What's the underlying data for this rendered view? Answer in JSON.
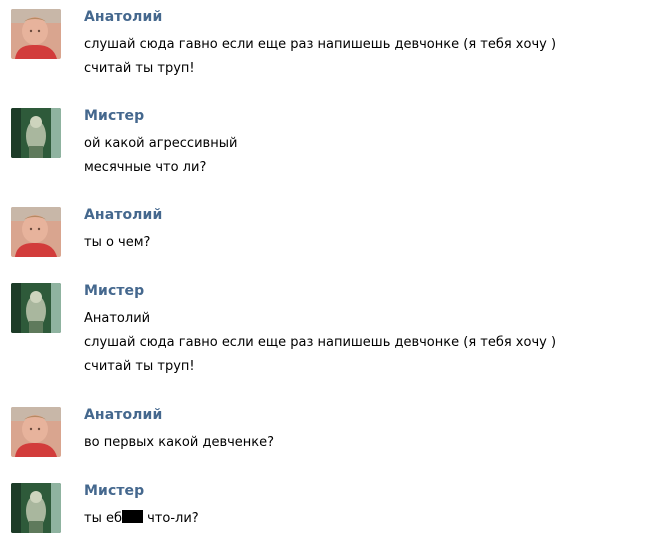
{
  "messages": [
    {
      "author": "Анатолий",
      "avatar_icon": "user-avatar-boy-red-shirt",
      "lines": [
        "слушай сюда гавно если еще раз напишешь девчонке (я тебя хочу )",
        "считай ты труп!"
      ]
    },
    {
      "author": "Мистер",
      "avatar_icon": "user-avatar-green-scene",
      "lines": [
        "ой какой агрессивный",
        "месячные что ли?"
      ]
    },
    {
      "author": "Анатолий",
      "avatar_icon": "user-avatar-boy-red-shirt",
      "lines": [
        "ты о чем?"
      ]
    },
    {
      "author": "Мистер",
      "avatar_icon": "user-avatar-green-scene",
      "lines": [
        "Анатолий",
        "слушай сюда гавно если еще раз напишешь девчонке (я тебя хочу )",
        "считай ты труп!"
      ]
    },
    {
      "author": "Анатолий",
      "avatar_icon": "user-avatar-boy-red-shirt",
      "lines": [
        "во первых какой девченке?"
      ]
    },
    {
      "author": "Мистер",
      "avatar_icon": "user-avatar-green-scene",
      "lines": [],
      "censored_line": {
        "before": "ты еб",
        "after": " что-ли?"
      }
    }
  ],
  "colors": {
    "author_name": "#45688e",
    "message_text": "#000000",
    "background": "#ffffff"
  }
}
